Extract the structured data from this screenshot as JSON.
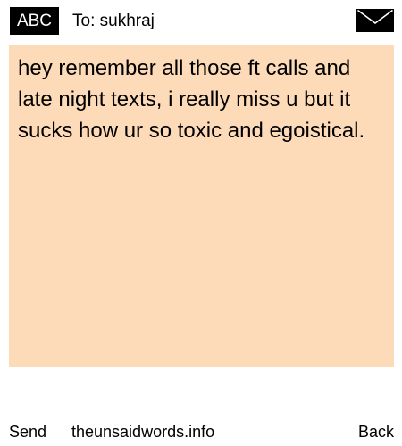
{
  "header": {
    "mode_label": "ABC",
    "recipient": "To: sukhraj",
    "icon": "envelope-icon"
  },
  "message": {
    "text": "hey remember all those ft calls and late night texts, i really miss u but it sucks how ur so toxic and egoistical."
  },
  "footer": {
    "send_label": "Send",
    "site_label": "theunsaidwords.info",
    "back_label": "Back"
  },
  "colors": {
    "message_background": "#fddbb8",
    "badge_background": "#000000",
    "badge_text": "#ffffff"
  }
}
